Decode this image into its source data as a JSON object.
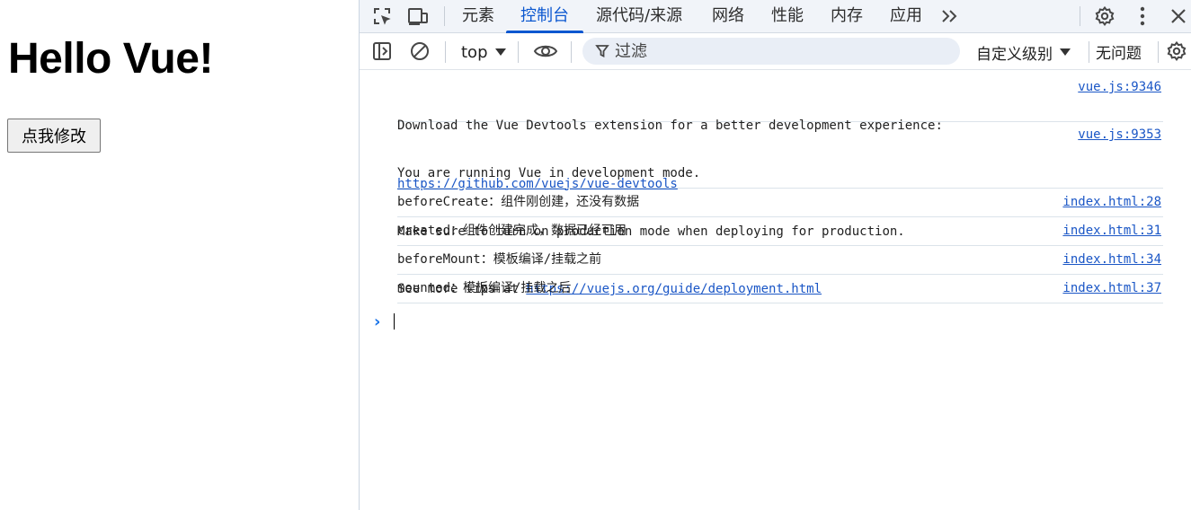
{
  "page": {
    "heading": "Hello Vue!",
    "button_label": "点我修改"
  },
  "devtools": {
    "tabs": [
      {
        "label": "元素",
        "active": false
      },
      {
        "label": "控制台",
        "active": true
      },
      {
        "label": "源代码/来源",
        "active": false
      },
      {
        "label": "网络",
        "active": false
      },
      {
        "label": "性能",
        "active": false
      },
      {
        "label": "内存",
        "active": false
      },
      {
        "label": "应用",
        "active": false
      }
    ],
    "icons": {
      "inspect": "inspect-element-icon",
      "device": "device-toolbar-icon",
      "more_tabs": "more-tabs-icon",
      "settings": "settings-gear-icon",
      "menu": "kebab-menu-icon",
      "close": "close-icon"
    },
    "console_toolbar": {
      "context": "top",
      "filter_placeholder": "过滤",
      "levels": "自定义级别",
      "issues": "无问题"
    },
    "messages": [
      {
        "lines": [
          "Download the Vue Devtools extension for a better development experience:"
        ],
        "link": "https://github.com/vuejs/vue-devtools",
        "source": "vue.js:9346"
      },
      {
        "lines": [
          "You are running Vue in development mode.",
          "Make sure to turn on production mode when deploying for production."
        ],
        "prefix": "See more tips at ",
        "link": "https://vuejs.org/guide/deployment.html",
        "source": "vue.js:9353"
      },
      {
        "text": "beforeCreate：组件刚创建，还没有数据",
        "source": "index.html:28"
      },
      {
        "text": "created：组件创建完成，数据已经可用",
        "source": "index.html:31"
      },
      {
        "text": "beforeMount：模板编译/挂载之前",
        "source": "index.html:34"
      },
      {
        "text": "mounted：模板编译/挂载之后",
        "source": "index.html:37"
      }
    ],
    "colors": {
      "accent": "#0b57d0",
      "link": "#1a56c6",
      "toolbar_bg": "#f1f4f9",
      "filter_bg": "#e9eef6"
    }
  }
}
